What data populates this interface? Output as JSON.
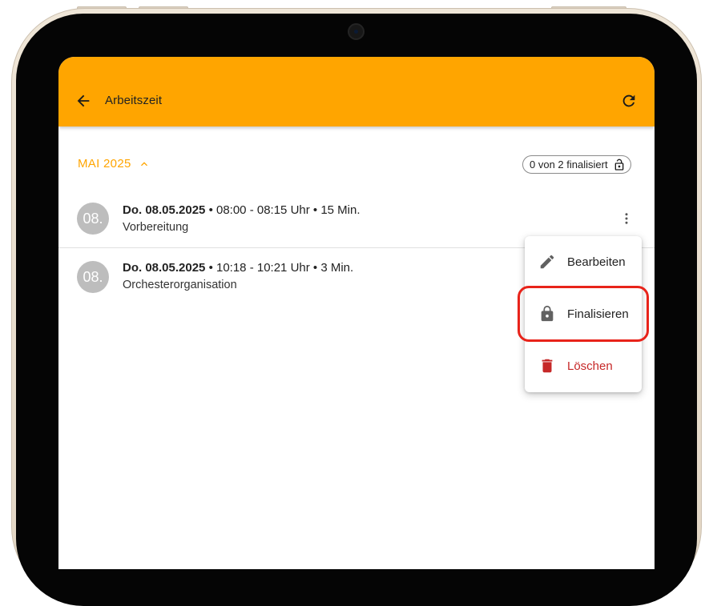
{
  "appbar": {
    "title": "Arbeitszeit",
    "back_icon": "arrow-back-icon",
    "refresh_icon": "refresh-icon",
    "color": "#FFA500"
  },
  "month_header": {
    "label": "MAI 2025",
    "icon": "chevron-up-icon"
  },
  "finalize_badge": {
    "text": "0 von 2 finalisiert",
    "icon": "lock-open-icon"
  },
  "entries": [
    {
      "avatar": "08.",
      "date": "Do. 08.05.2025",
      "details": " • 08:00 - 08:15 Uhr • 15 Min.",
      "description": "Vorbereitung"
    },
    {
      "avatar": "08.",
      "date": "Do. 08.05.2025",
      "details": " • 10:18 - 10:21 Uhr • 3 Min.",
      "description": "Orchesterorganisation"
    }
  ],
  "context_menu": {
    "items": [
      {
        "label": "Bearbeiten",
        "icon": "pencil-icon"
      },
      {
        "label": "Finalisieren",
        "icon": "lock-icon"
      },
      {
        "label": "Löschen",
        "icon": "trash-icon",
        "color": "#c62828"
      }
    ]
  },
  "colors": {
    "accent": "#FFA500",
    "danger": "#c62828",
    "highlight": "#e8231a"
  }
}
